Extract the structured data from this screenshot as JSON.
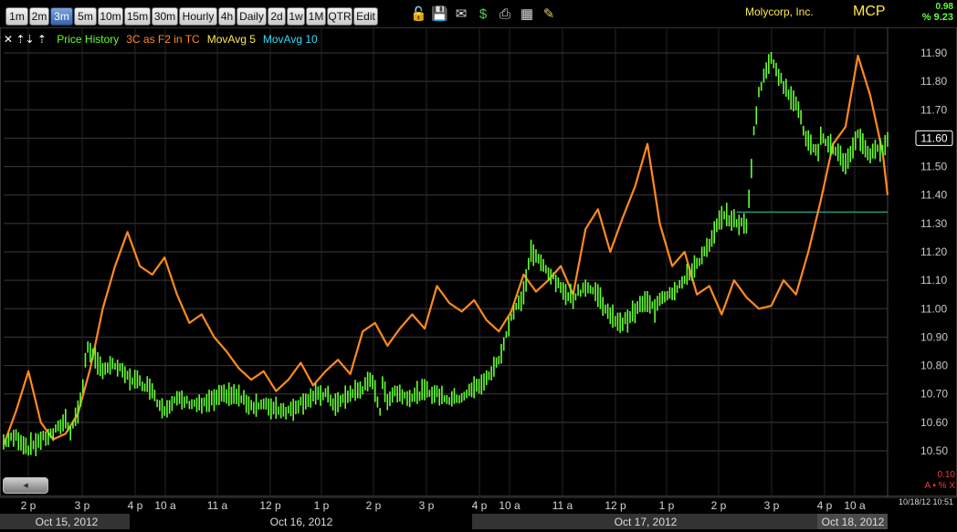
{
  "toolbar": {
    "timeframes": [
      "1m",
      "2m",
      "3m",
      "5m",
      "10m",
      "15m",
      "30m",
      "Hourly",
      "4h",
      "Daily",
      "2d",
      "1w",
      "1M",
      "QTR",
      "Edit"
    ],
    "active": "3m",
    "icons": [
      "lock-icon",
      "save-icon",
      "mail-icon",
      "dollar-icon",
      "print-icon",
      "grid-icon",
      "pencil-icon"
    ]
  },
  "header": {
    "company": "Molycorp, Inc.",
    "symbol": "MCP",
    "change": "0.98",
    "change_pct": "% 9.23"
  },
  "legend": {
    "controls": "✕ ⇡⇣ ⇡",
    "items": [
      {
        "label": "Price History",
        "color": "#66ff33"
      },
      {
        "label": "3C as F2 in TC",
        "color": "#ff8a1e"
      },
      {
        "label": "MovAvg 5",
        "color": "#ffe84d"
      },
      {
        "label": "MovAvg 10",
        "color": "#33ddff"
      }
    ]
  },
  "footer": {
    "scroll_label": "◂",
    "tc_value": "0.10",
    "tc_controls": "A ▪ % X",
    "timestamp": "10/18/12 10:51"
  },
  "chart_data": {
    "type": "line",
    "ylim": [
      10.44,
      11.95
    ],
    "y_ticks": [
      "11.90",
      "11.80",
      "11.70",
      "11.60",
      "11.50",
      "11.40",
      "11.30",
      "11.20",
      "11.10",
      "11.00",
      "10.90",
      "10.80",
      "10.70",
      "10.60",
      "10.50"
    ],
    "last_price": "11.60",
    "reference_line": 11.34,
    "x_ticks": [
      "2 p",
      "3 p",
      "4 p",
      "10 a",
      "11 a",
      "12 p",
      "1 p",
      "2 p",
      "3 p",
      "4 p",
      "10 a",
      "11 a",
      "12 p",
      "1 p",
      "2 p",
      "3 p",
      "4 p",
      "10 a"
    ],
    "dates": [
      "Oct 15, 2012",
      "Oct 16, 2012",
      "Oct 17, 2012",
      "Oct 18, 2012"
    ],
    "series": [
      {
        "name": "Price History",
        "color": "#66ff33",
        "x": [
          0,
          5,
          10,
          15,
          20,
          25,
          27,
          30,
          32,
          33,
          34,
          38,
          40,
          45,
          50,
          55,
          60,
          62,
          65,
          70,
          75,
          80,
          85,
          90,
          95,
          100,
          105,
          110,
          115,
          120,
          125,
          130,
          134,
          140,
          145,
          149,
          152,
          153,
          155,
          158,
          160,
          165,
          170,
          175,
          180,
          185,
          190,
          195,
          200,
          205,
          210,
          212,
          213,
          215,
          220,
          225,
          230,
          235,
          240,
          245,
          250,
          255,
          258,
          260,
          263,
          265,
          270,
          275,
          280,
          285,
          290,
          295,
          300,
          302,
          303,
          305,
          310,
          315,
          320,
          324,
          327,
          329,
          330,
          335,
          340,
          345,
          350,
          355,
          357
        ],
        "y": [
          10.53,
          10.55,
          10.51,
          10.54,
          10.56,
          10.61,
          10.57,
          10.64,
          10.72,
          10.82,
          10.87,
          10.8,
          10.79,
          10.8,
          10.76,
          10.74,
          10.72,
          10.67,
          10.65,
          10.68,
          10.67,
          10.66,
          10.68,
          10.7,
          10.69,
          10.66,
          10.66,
          10.65,
          10.64,
          10.67,
          10.69,
          10.7,
          10.66,
          10.7,
          10.72,
          10.75,
          10.64,
          10.73,
          10.68,
          10.71,
          10.7,
          10.69,
          10.71,
          10.7,
          10.68,
          10.69,
          10.72,
          10.75,
          10.82,
          10.97,
          11.05,
          11.16,
          11.2,
          11.18,
          11.13,
          11.07,
          11.04,
          11.08,
          11.05,
          10.97,
          10.95,
          10.99,
          11.02,
          11.02,
          11.0,
          11.04,
          11.06,
          11.1,
          11.16,
          11.22,
          11.33,
          11.31,
          11.29,
          11.5,
          11.62,
          11.76,
          11.89,
          11.78,
          11.73,
          11.6,
          11.56,
          11.54,
          11.6,
          11.57,
          11.51,
          11.61,
          11.54,
          11.57,
          11.6
        ]
      },
      {
        "name": "3C as F2 in TC",
        "color": "#ff8a1e",
        "x": [
          0,
          5,
          10,
          15,
          20,
          25,
          30,
          35,
          40,
          45,
          50,
          55,
          60,
          65,
          70,
          75,
          80,
          85,
          90,
          95,
          100,
          105,
          110,
          115,
          120,
          125,
          130,
          135,
          140,
          145,
          150,
          155,
          160,
          165,
          170,
          175,
          180,
          185,
          190,
          195,
          200,
          205,
          210,
          215,
          220,
          225,
          230,
          235,
          240,
          245,
          250,
          255,
          260,
          265,
          270,
          275,
          280,
          285,
          290,
          295,
          300,
          305,
          310,
          315,
          320,
          325,
          330,
          335,
          340,
          345,
          350,
          355,
          357
        ],
        "y": [
          10.52,
          10.64,
          10.78,
          10.6,
          10.54,
          10.56,
          10.63,
          10.79,
          11.0,
          11.15,
          11.27,
          11.15,
          11.12,
          11.18,
          11.05,
          10.95,
          10.98,
          10.9,
          10.85,
          10.79,
          10.75,
          10.78,
          10.71,
          10.75,
          10.81,
          10.73,
          10.78,
          10.82,
          10.77,
          10.92,
          10.95,
          10.87,
          10.93,
          10.98,
          10.93,
          11.08,
          11.02,
          10.99,
          11.03,
          10.96,
          10.92,
          10.99,
          11.12,
          11.06,
          11.1,
          11.15,
          11.05,
          11.28,
          11.35,
          11.2,
          11.32,
          11.43,
          11.58,
          11.3,
          11.15,
          11.2,
          11.05,
          11.08,
          10.98,
          11.1,
          11.04,
          11.0,
          11.01,
          11.1,
          11.05,
          11.2,
          11.38,
          11.58,
          11.64,
          11.89,
          11.75,
          11.55,
          11.4
        ]
      }
    ]
  }
}
